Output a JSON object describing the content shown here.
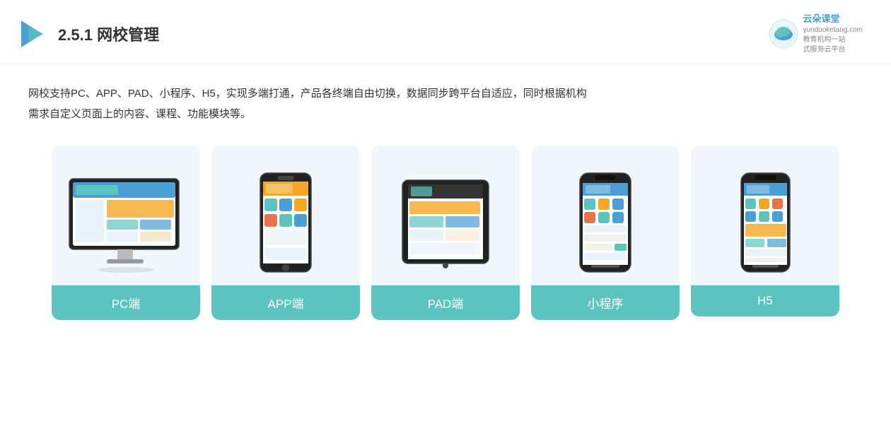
{
  "header": {
    "section_number": "2.5.1",
    "title": "网校管理",
    "brand": {
      "name": "云朵课堂",
      "domain": "yunduoketang.com",
      "slogan_line1": "教育机构一站",
      "slogan_line2": "式服务云平台"
    }
  },
  "description": {
    "text_line1": "网校支持PC、APP、PAD、小程序、H5，实现多端打通，产品各终端自由切换，数据同步跨平台自适应，同时根据机构",
    "text_line2": "需求自定义页面上的内容、课程、功能模块等。"
  },
  "cards": [
    {
      "id": "pc",
      "label": "PC端"
    },
    {
      "id": "app",
      "label": "APP端"
    },
    {
      "id": "pad",
      "label": "PAD端"
    },
    {
      "id": "miniprogram",
      "label": "小程序"
    },
    {
      "id": "h5",
      "label": "H5"
    }
  ],
  "colors": {
    "teal": "#5bc4c0",
    "light_blue_bg": "#e8f2fb",
    "accent_orange": "#f5a623",
    "text_dark": "#333333",
    "text_gray": "#888888",
    "brand_blue": "#4a9fd4"
  }
}
